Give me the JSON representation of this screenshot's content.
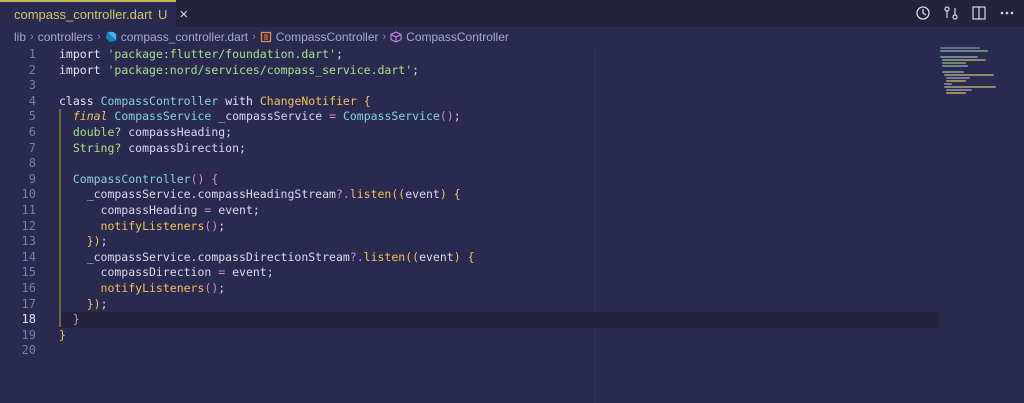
{
  "tab": {
    "filename": "compass_controller.dart",
    "status": "U",
    "close": "×"
  },
  "breadcrumb": {
    "items": [
      "lib",
      "controllers",
      "compass_controller.dart",
      "CompassController",
      "CompassController"
    ]
  },
  "editor": {
    "active_line": "18",
    "line_numbers": [
      "1",
      "2",
      "3",
      "4",
      "5",
      "6",
      "7",
      "8",
      "9",
      "10",
      "11",
      "12",
      "13",
      "14",
      "15",
      "16",
      "17",
      "18",
      "19",
      "20"
    ]
  },
  "colors": {
    "accent": "#c8b95a",
    "background": "#2a2950",
    "tabbar": "#24233f"
  },
  "icons": [
    "dart-file-icon",
    "close-icon",
    "history-icon",
    "compare-changes-icon",
    "split-editor-icon",
    "more-actions-icon",
    "chevron-right-icon",
    "class-icon",
    "cube-icon"
  ]
}
